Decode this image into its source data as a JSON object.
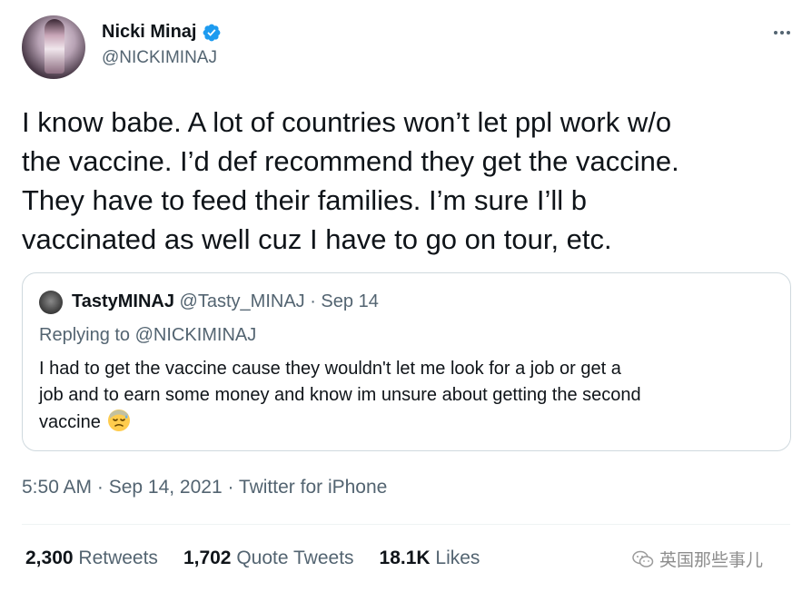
{
  "author": {
    "display_name": "Nicki Minaj",
    "handle": "@NICKIMINAJ",
    "verified_color": "#1d9bf0"
  },
  "tweet": {
    "lines": [
      "I know babe. A lot of countries won’t let ppl work w/o",
      "the vaccine. I’d def recommend they get the vaccine.",
      "They have to feed their families. I’m sure I’ll b",
      "vaccinated as well cuz I have to go on tour, etc."
    ],
    "timestamp": "5:50 AM · Sep 14, 2021 · Twitter for iPhone"
  },
  "quoted_tweet": {
    "name": "TastyMINAJ",
    "meta": " @Tasty_MINAJ · Sep 14",
    "replying_to": "Replying to @NICKIMINAJ",
    "lines": [
      "I had to get the vaccine cause they wouldn't let me look for a job or get a",
      "job and to earn some money and know im unsure about getting the second",
      "vaccine"
    ],
    "emoji": "downcast-face-with-sweat-icon"
  },
  "stats": {
    "retweets_count": "2,300",
    "retweets_label": " Retweets",
    "quotes_count": "1,702",
    "quotes_label": " Quote Tweets",
    "likes_count": "18.1K",
    "likes_label": " Likes"
  },
  "watermark": {
    "text": "英国那些事儿"
  },
  "colors": {
    "text": "#0f1419",
    "secondary": "#536471",
    "border": "#cfd9de"
  }
}
